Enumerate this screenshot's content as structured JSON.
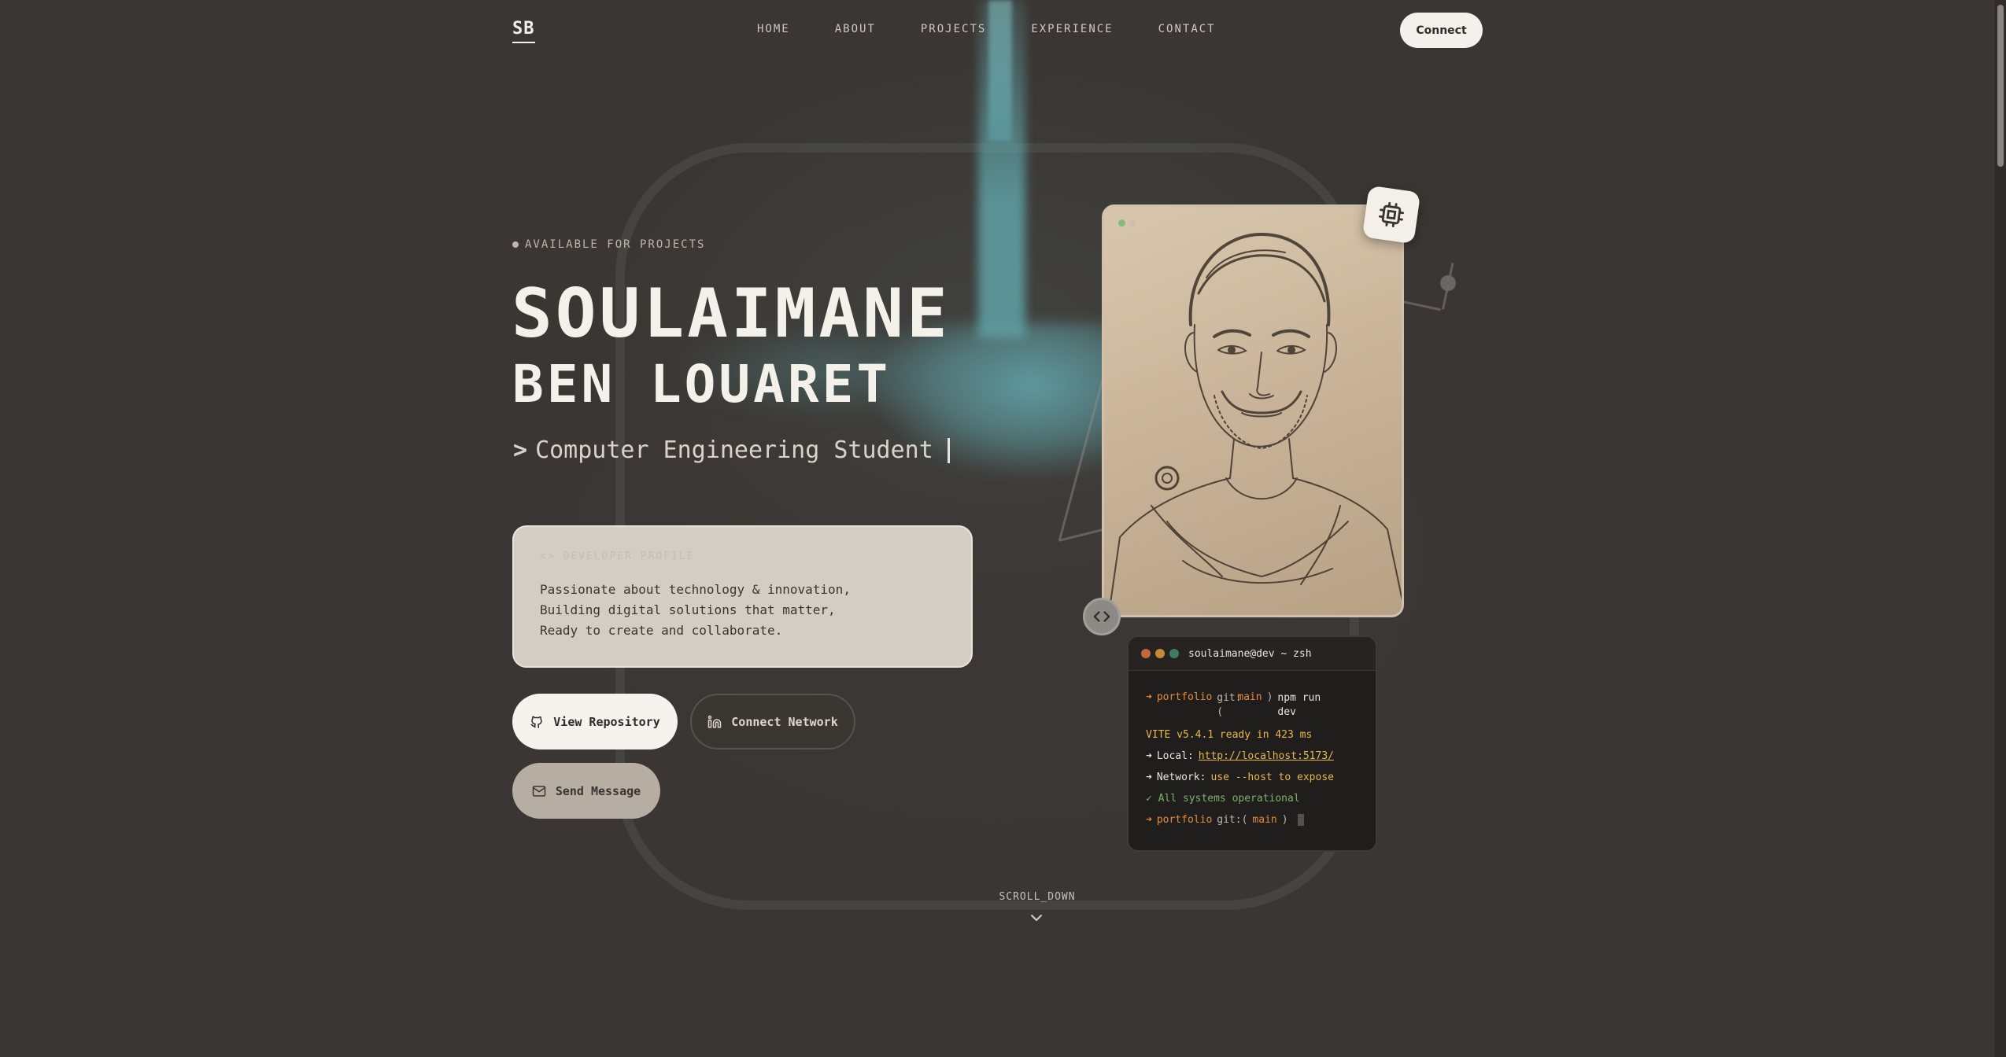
{
  "nav": {
    "logo": "SB",
    "links": [
      "HOME",
      "ABOUT",
      "PROJECTS",
      "EXPERIENCE",
      "CONTACT"
    ],
    "connect_label": "Connect"
  },
  "hero": {
    "status": "AVAILABLE FOR PROJECTS",
    "name_first": "SOULAIMANE",
    "name_last": "BEN LOUARET",
    "role": "Computer Engineering Student",
    "profile": {
      "label": "<> DEVELOPER PROFILE",
      "lines": [
        "Passionate about technology & innovation,",
        "Building digital solutions that matter,",
        "Ready to create and collaborate."
      ]
    },
    "buttons": {
      "repo": "View Repository",
      "network": "Connect Network",
      "message": "Send Message"
    }
  },
  "terminal": {
    "title": "soulaimane@dev ~ zsh",
    "dir": "portfolio",
    "git_prefix": "git:(",
    "branch": "main",
    "git_suffix": ")",
    "command": "npm run dev",
    "vite": "VITE v5.4.1 ready in 423 ms",
    "local_label": "Local:",
    "local_url": "http://localhost:5173/",
    "network_label": "Network:",
    "network_value": "use --host to expose",
    "status": "✓ All systems operational"
  },
  "scroll_label": "SCROLL_DOWN",
  "icons": {
    "chip": "cpu-chip-icon",
    "code": "code-brackets-icon",
    "github": "github-icon",
    "linkedin": "linkedin-icon",
    "mail": "mail-icon",
    "chevron": "chevron-down-icon"
  },
  "colors": {
    "background": "#3a3633",
    "accent_teal": "#609ea3",
    "card": "#d4cdc4",
    "terminal_orange": "#e58a3e",
    "terminal_yellow": "#e7b84c",
    "terminal_green": "#7fb06a"
  }
}
